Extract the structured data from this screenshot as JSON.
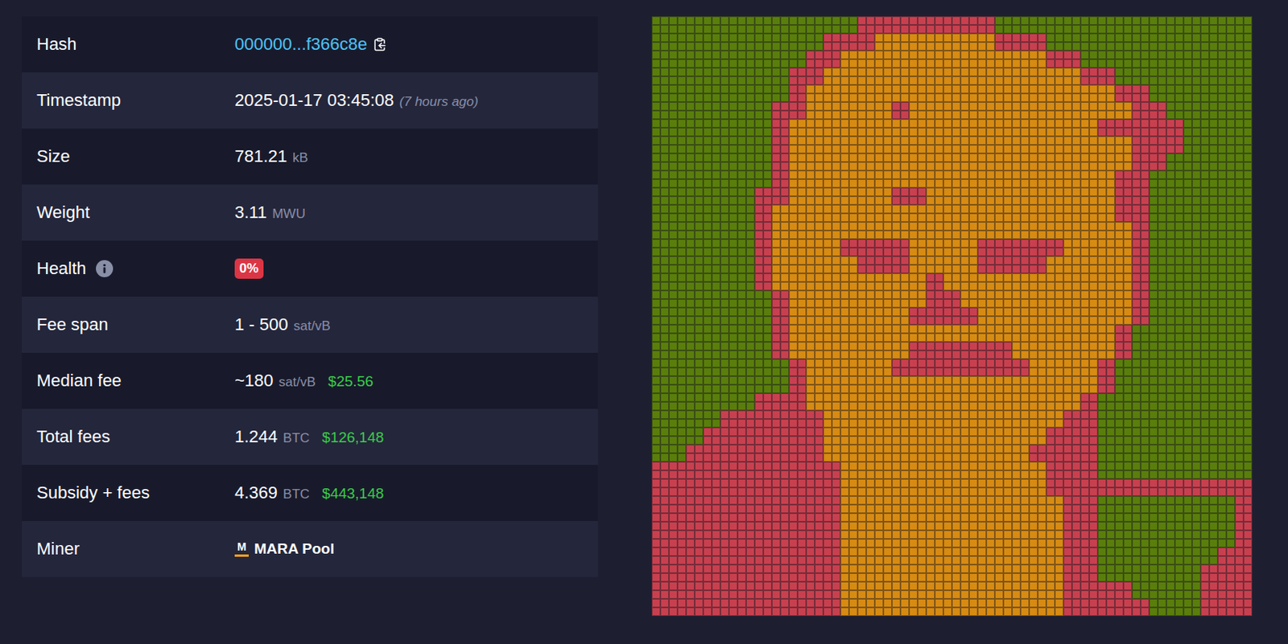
{
  "block_details": [
    {
      "label": "Hash",
      "kind": "hash",
      "value": "000000...f366c8e"
    },
    {
      "label": "Timestamp",
      "kind": "plain",
      "value": "2025-01-17 03:45:08",
      "note": "(7 hours ago)"
    },
    {
      "label": "Size",
      "kind": "plain",
      "value": "781.21",
      "unit": "kB"
    },
    {
      "label": "Weight",
      "kind": "plain",
      "value": "3.11",
      "unit": "MWU"
    },
    {
      "label": "Health",
      "kind": "badge",
      "value": "0%"
    },
    {
      "label": "Fee span",
      "kind": "plain",
      "value": "1 - 500",
      "unit": "sat/vB"
    },
    {
      "label": "Median fee",
      "kind": "plain",
      "value": "~180",
      "unit": "sat/vB",
      "fiat": "$25.56"
    },
    {
      "label": "Total fees",
      "kind": "plain",
      "value": "1.244",
      "unit": "BTC",
      "fiat": "$126,148"
    },
    {
      "label": "Subsidy + fees",
      "kind": "plain",
      "value": "4.369",
      "unit": "BTC",
      "fiat": "$443,148"
    },
    {
      "label": "Miner",
      "kind": "miner",
      "value": "MARA Pool",
      "logo_letter": "M"
    }
  ],
  "block_visual": {
    "palette": {
      "g": "#5a7e0b",
      "r": "#c8404f",
      "o": "#d78b12"
    },
    "rows": [
      [
        [
          "g",
          12
        ],
        [
          "r",
          8
        ],
        [
          "g",
          15
        ]
      ],
      [
        [
          "g",
          10
        ],
        [
          "r",
          3
        ],
        [
          "o",
          7
        ],
        [
          "r",
          3
        ],
        [
          "g",
          12
        ]
      ],
      [
        [
          "g",
          9
        ],
        [
          "r",
          2
        ],
        [
          "o",
          12
        ],
        [
          "r",
          2
        ],
        [
          "g",
          10
        ]
      ],
      [
        [
          "g",
          8
        ],
        [
          "r",
          2
        ],
        [
          "o",
          15
        ],
        [
          "r",
          2
        ],
        [
          "g",
          8
        ]
      ],
      [
        [
          "g",
          8
        ],
        [
          "r",
          1
        ],
        [
          "o",
          18
        ],
        [
          "r",
          2
        ],
        [
          "g",
          6
        ]
      ],
      [
        [
          "g",
          7
        ],
        [
          "r",
          2
        ],
        [
          "o",
          5
        ],
        [
          "r",
          1
        ],
        [
          "o",
          13
        ],
        [
          "r",
          2
        ],
        [
          "g",
          5
        ]
      ],
      [
        [
          "g",
          7
        ],
        [
          "r",
          1
        ],
        [
          "o",
          18
        ],
        [
          "r",
          5
        ],
        [
          "g",
          4
        ]
      ],
      [
        [
          "g",
          7
        ],
        [
          "r",
          1
        ],
        [
          "o",
          20
        ],
        [
          "r",
          3
        ],
        [
          "g",
          4
        ]
      ],
      [
        [
          "g",
          7
        ],
        [
          "r",
          1
        ],
        [
          "o",
          20
        ],
        [
          "r",
          2
        ],
        [
          "g",
          5
        ]
      ],
      [
        [
          "g",
          7
        ],
        [
          "r",
          1
        ],
        [
          "o",
          19
        ],
        [
          "r",
          2
        ],
        [
          "g",
          6
        ]
      ],
      [
        [
          "g",
          6
        ],
        [
          "r",
          2
        ],
        [
          "o",
          6
        ],
        [
          "r",
          2
        ],
        [
          "o",
          11
        ],
        [
          "r",
          2
        ],
        [
          "g",
          6
        ]
      ],
      [
        [
          "g",
          6
        ],
        [
          "r",
          1
        ],
        [
          "o",
          20
        ],
        [
          "r",
          2
        ],
        [
          "g",
          6
        ]
      ],
      [
        [
          "g",
          6
        ],
        [
          "r",
          1
        ],
        [
          "o",
          21
        ],
        [
          "r",
          1
        ],
        [
          "g",
          6
        ]
      ],
      [
        [
          "g",
          6
        ],
        [
          "r",
          1
        ],
        [
          "o",
          4
        ],
        [
          "r",
          4
        ],
        [
          "o",
          4
        ],
        [
          "r",
          5
        ],
        [
          "o",
          4
        ],
        [
          "r",
          1
        ],
        [
          "g",
          6
        ]
      ],
      [
        [
          "g",
          6
        ],
        [
          "r",
          1
        ],
        [
          "o",
          5
        ],
        [
          "r",
          3
        ],
        [
          "o",
          4
        ],
        [
          "r",
          4
        ],
        [
          "o",
          5
        ],
        [
          "r",
          1
        ],
        [
          "g",
          6
        ]
      ],
      [
        [
          "g",
          6
        ],
        [
          "r",
          1
        ],
        [
          "o",
          9
        ],
        [
          "r",
          1
        ],
        [
          "o",
          11
        ],
        [
          "r",
          1
        ],
        [
          "g",
          6
        ]
      ],
      [
        [
          "g",
          7
        ],
        [
          "r",
          1
        ],
        [
          "o",
          8
        ],
        [
          "r",
          2
        ],
        [
          "o",
          10
        ],
        [
          "r",
          1
        ],
        [
          "g",
          6
        ]
      ],
      [
        [
          "g",
          7
        ],
        [
          "r",
          1
        ],
        [
          "o",
          7
        ],
        [
          "r",
          4
        ],
        [
          "o",
          9
        ],
        [
          "r",
          1
        ],
        [
          "g",
          6
        ]
      ],
      [
        [
          "g",
          7
        ],
        [
          "r",
          1
        ],
        [
          "o",
          19
        ],
        [
          "r",
          1
        ],
        [
          "g",
          7
        ]
      ],
      [
        [
          "g",
          7
        ],
        [
          "r",
          1
        ],
        [
          "o",
          7
        ],
        [
          "r",
          6
        ],
        [
          "o",
          6
        ],
        [
          "r",
          1
        ],
        [
          "g",
          7
        ]
      ],
      [
        [
          "g",
          8
        ],
        [
          "r",
          1
        ],
        [
          "o",
          5
        ],
        [
          "r",
          8
        ],
        [
          "o",
          4
        ],
        [
          "r",
          1
        ],
        [
          "g",
          8
        ]
      ],
      [
        [
          "g",
          8
        ],
        [
          "r",
          1
        ],
        [
          "o",
          17
        ],
        [
          "r",
          1
        ],
        [
          "g",
          8
        ]
      ],
      [
        [
          "g",
          6
        ],
        [
          "r",
          3
        ],
        [
          "o",
          16
        ],
        [
          "r",
          1
        ],
        [
          "g",
          9
        ]
      ],
      [
        [
          "g",
          4
        ],
        [
          "r",
          6
        ],
        [
          "o",
          14
        ],
        [
          "r",
          2
        ],
        [
          "g",
          9
        ]
      ],
      [
        [
          "g",
          3
        ],
        [
          "r",
          7
        ],
        [
          "o",
          13
        ],
        [
          "r",
          3
        ],
        [
          "g",
          9
        ]
      ],
      [
        [
          "g",
          2
        ],
        [
          "r",
          8
        ],
        [
          "o",
          12
        ],
        [
          "r",
          4
        ],
        [
          "g",
          9
        ]
      ],
      [
        [
          "r",
          11
        ],
        [
          "o",
          12
        ],
        [
          "r",
          3
        ],
        [
          "g",
          9
        ]
      ],
      [
        [
          "r",
          11
        ],
        [
          "o",
          12
        ],
        [
          "r",
          12
        ]
      ],
      [
        [
          "r",
          11
        ],
        [
          "o",
          13
        ],
        [
          "r",
          2
        ],
        [
          "g",
          8
        ],
        [
          "r",
          1
        ]
      ],
      [
        [
          "r",
          11
        ],
        [
          "o",
          13
        ],
        [
          "r",
          2
        ],
        [
          "g",
          8
        ],
        [
          "r",
          1
        ]
      ],
      [
        [
          "r",
          11
        ],
        [
          "o",
          13
        ],
        [
          "r",
          2
        ],
        [
          "g",
          8
        ],
        [
          "r",
          1
        ]
      ],
      [
        [
          "r",
          11
        ],
        [
          "o",
          13
        ],
        [
          "r",
          2
        ],
        [
          "g",
          7
        ],
        [
          "r",
          2
        ]
      ],
      [
        [
          "r",
          11
        ],
        [
          "o",
          13
        ],
        [
          "r",
          2
        ],
        [
          "g",
          6
        ],
        [
          "r",
          3
        ]
      ],
      [
        [
          "r",
          11
        ],
        [
          "o",
          13
        ],
        [
          "r",
          4
        ],
        [
          "g",
          4
        ],
        [
          "r",
          3
        ]
      ],
      [
        [
          "r",
          11
        ],
        [
          "o",
          13
        ],
        [
          "r",
          5
        ],
        [
          "g",
          3
        ],
        [
          "r",
          3
        ]
      ]
    ]
  }
}
